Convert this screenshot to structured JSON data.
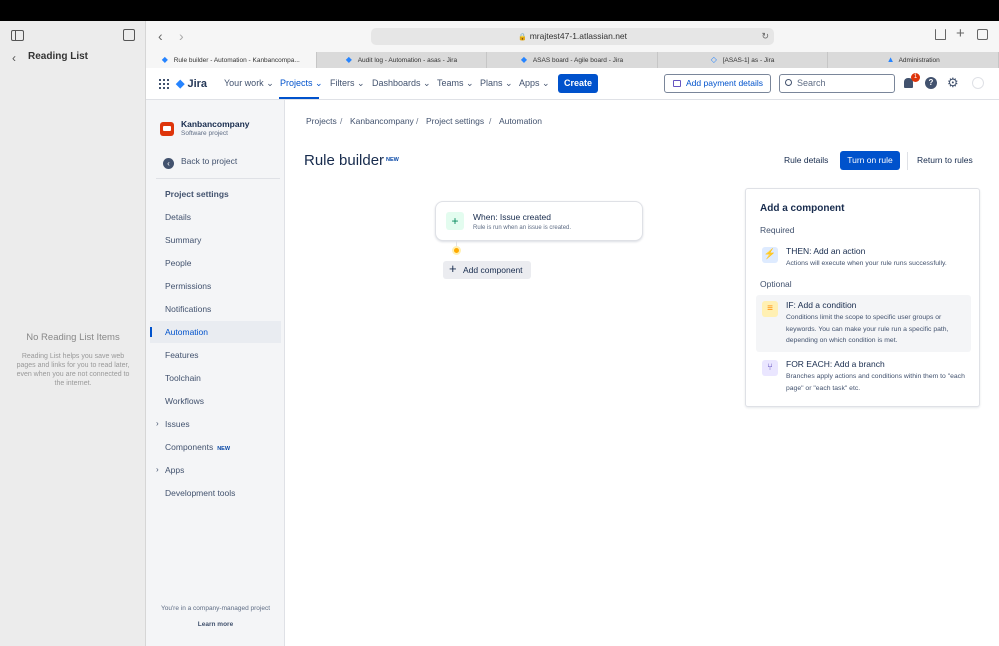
{
  "reading_list": {
    "title": "Reading List",
    "empty_title": "No Reading List Items",
    "empty_desc": "Reading List helps you save web pages and links for you to read later, even when you are not connected to the internet."
  },
  "browser": {
    "url": "mrajtest47-1.atlassian.net",
    "tabs": [
      {
        "label": "Rule builder - Automation - Kanbancompa..."
      },
      {
        "label": "Audit log - Automation - asas - Jira"
      },
      {
        "label": "ASAS board - Agile board - Jira"
      },
      {
        "label": "[ASAS-1] as - Jira"
      },
      {
        "label": "Administration"
      }
    ]
  },
  "header": {
    "logo": "Jira",
    "nav": [
      "Your work",
      "Projects",
      "Filters",
      "Dashboards",
      "Teams",
      "Plans",
      "Apps"
    ],
    "create": "Create",
    "payment": "Add payment details",
    "search_placeholder": "Search",
    "notifications_count": "1",
    "help": "?"
  },
  "sidebar": {
    "project_name": "Kanbancompany",
    "project_type": "Software project",
    "back": "Back to project",
    "heading": "Project settings",
    "items": [
      {
        "label": "Details"
      },
      {
        "label": "Summary"
      },
      {
        "label": "People"
      },
      {
        "label": "Permissions"
      },
      {
        "label": "Notifications"
      },
      {
        "label": "Automation"
      },
      {
        "label": "Features"
      },
      {
        "label": "Toolchain"
      },
      {
        "label": "Workflows"
      },
      {
        "label": "Issues"
      },
      {
        "label": "Components"
      },
      {
        "label": "Apps"
      },
      {
        "label": "Development tools"
      }
    ],
    "new_tag": "NEW",
    "footer": "You're in a company-managed project",
    "learn_more": "Learn more"
  },
  "breadcrumbs": [
    "Projects",
    "Kanbancompany",
    "Project settings",
    "Automation"
  ],
  "page": {
    "title": "Rule builder",
    "title_tag": "NEW",
    "rule_details": "Rule details",
    "turn_on": "Turn on rule",
    "return": "Return to rules"
  },
  "trigger": {
    "title": "When: Issue created",
    "subtitle": "Rule is run when an issue is created."
  },
  "add_component_button": "Add component",
  "panel": {
    "title": "Add a component",
    "required_label": "Required",
    "optional_label": "Optional",
    "then": {
      "title": "THEN: Add an action",
      "desc": "Actions will execute when your rule runs successfully."
    },
    "if": {
      "title": "IF: Add a condition",
      "desc": "Conditions limit the scope to specific user groups or keywords. You can make your rule run a specific path, depending on which condition is met."
    },
    "foreach": {
      "title": "FOR EACH: Add a branch",
      "desc": "Branches apply actions and conditions within them to \"each page\" or \"each task\" etc."
    }
  },
  "colors": {
    "primary": "#0052CC",
    "sidebar_bg": "#F4F5F7",
    "trigger_accent": "#00875A",
    "dot": "#FFAB00"
  }
}
